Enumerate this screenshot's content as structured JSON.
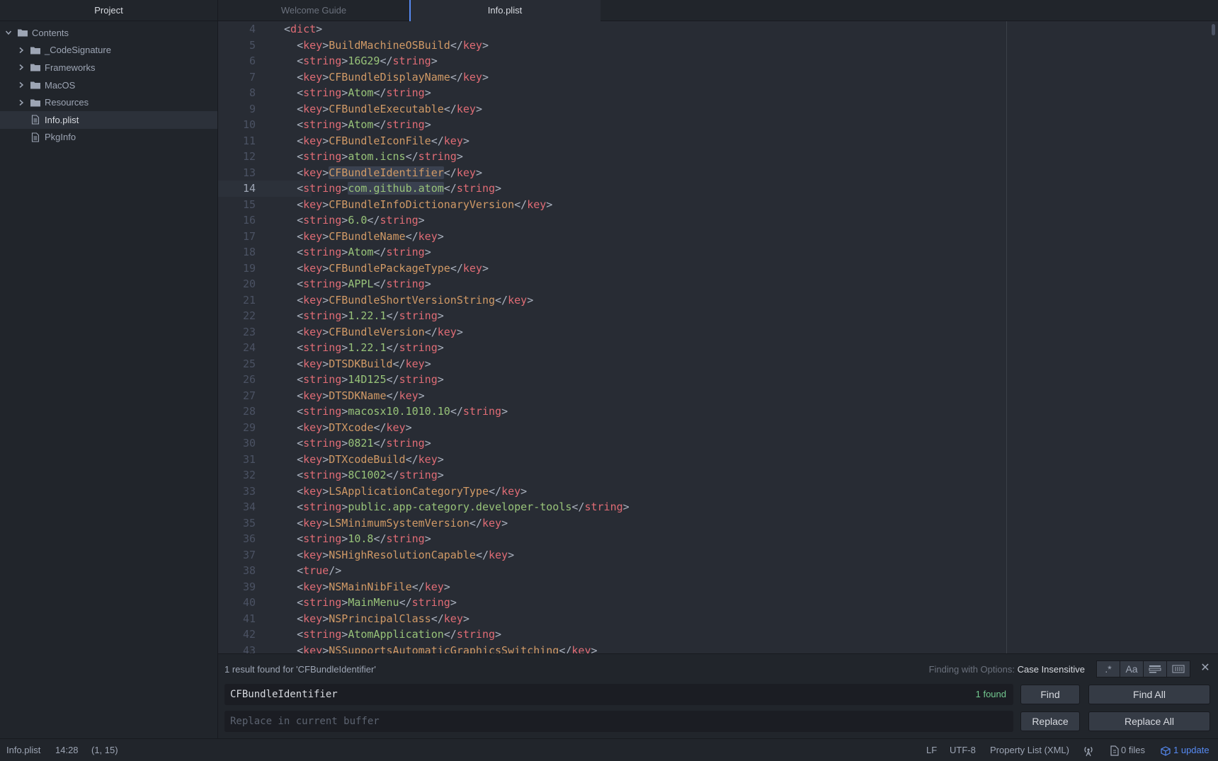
{
  "sidebar": {
    "header": "Project",
    "root": "Contents",
    "items": [
      {
        "label": "_CodeSignature",
        "type": "folder"
      },
      {
        "label": "Frameworks",
        "type": "folder"
      },
      {
        "label": "MacOS",
        "type": "folder"
      },
      {
        "label": "Resources",
        "type": "folder"
      },
      {
        "label": "Info.plist",
        "type": "file",
        "selected": true
      },
      {
        "label": "PkgInfo",
        "type": "file"
      }
    ]
  },
  "tabs": [
    {
      "label": "Welcome Guide",
      "active": false
    },
    {
      "label": "Info.plist",
      "active": true
    }
  ],
  "editor": {
    "current_line": 14,
    "lines": [
      {
        "n": "4",
        "indent": "",
        "tag": "dict",
        "kind": "open"
      },
      {
        "n": "5",
        "indent": "  ",
        "tag": "key",
        "value": "BuildMachineOSBuild"
      },
      {
        "n": "6",
        "indent": "  ",
        "tag": "string",
        "value": "16G29"
      },
      {
        "n": "7",
        "indent": "  ",
        "tag": "key",
        "value": "CFBundleDisplayName"
      },
      {
        "n": "8",
        "indent": "  ",
        "tag": "string",
        "value": "Atom"
      },
      {
        "n": "9",
        "indent": "  ",
        "tag": "key",
        "value": "CFBundleExecutable"
      },
      {
        "n": "10",
        "indent": "  ",
        "tag": "string",
        "value": "Atom"
      },
      {
        "n": "11",
        "indent": "  ",
        "tag": "key",
        "value": "CFBundleIconFile"
      },
      {
        "n": "12",
        "indent": "  ",
        "tag": "string",
        "value": "atom.icns"
      },
      {
        "n": "13",
        "indent": "  ",
        "tag": "key",
        "value": "CFBundleIdentifier",
        "highlight": true
      },
      {
        "n": "14",
        "indent": "  ",
        "tag": "string",
        "value": "com.github.atom",
        "highlight": true
      },
      {
        "n": "15",
        "indent": "  ",
        "tag": "key",
        "value": "CFBundleInfoDictionaryVersion"
      },
      {
        "n": "16",
        "indent": "  ",
        "tag": "string",
        "value": "6.0"
      },
      {
        "n": "17",
        "indent": "  ",
        "tag": "key",
        "value": "CFBundleName"
      },
      {
        "n": "18",
        "indent": "  ",
        "tag": "string",
        "value": "Atom"
      },
      {
        "n": "19",
        "indent": "  ",
        "tag": "key",
        "value": "CFBundlePackageType"
      },
      {
        "n": "20",
        "indent": "  ",
        "tag": "string",
        "value": "APPL"
      },
      {
        "n": "21",
        "indent": "  ",
        "tag": "key",
        "value": "CFBundleShortVersionString"
      },
      {
        "n": "22",
        "indent": "  ",
        "tag": "string",
        "value": "1.22.1"
      },
      {
        "n": "23",
        "indent": "  ",
        "tag": "key",
        "value": "CFBundleVersion"
      },
      {
        "n": "24",
        "indent": "  ",
        "tag": "string",
        "value": "1.22.1"
      },
      {
        "n": "25",
        "indent": "  ",
        "tag": "key",
        "value": "DTSDKBuild"
      },
      {
        "n": "26",
        "indent": "  ",
        "tag": "string",
        "value": "14D125"
      },
      {
        "n": "27",
        "indent": "  ",
        "tag": "key",
        "value": "DTSDKName"
      },
      {
        "n": "28",
        "indent": "  ",
        "tag": "string",
        "value": "macosx10.1010.10"
      },
      {
        "n": "29",
        "indent": "  ",
        "tag": "key",
        "value": "DTXcode"
      },
      {
        "n": "30",
        "indent": "  ",
        "tag": "string",
        "value": "0821"
      },
      {
        "n": "31",
        "indent": "  ",
        "tag": "key",
        "value": "DTXcodeBuild"
      },
      {
        "n": "32",
        "indent": "  ",
        "tag": "string",
        "value": "8C1002"
      },
      {
        "n": "33",
        "indent": "  ",
        "tag": "key",
        "value": "LSApplicationCategoryType"
      },
      {
        "n": "34",
        "indent": "  ",
        "tag": "string",
        "value": "public.app-category.developer-tools"
      },
      {
        "n": "35",
        "indent": "  ",
        "tag": "key",
        "value": "LSMinimumSystemVersion"
      },
      {
        "n": "36",
        "indent": "  ",
        "tag": "string",
        "value": "10.8"
      },
      {
        "n": "37",
        "indent": "  ",
        "tag": "key",
        "value": "NSHighResolutionCapable"
      },
      {
        "n": "38",
        "indent": "  ",
        "tag": "true",
        "kind": "selfclose"
      },
      {
        "n": "39",
        "indent": "  ",
        "tag": "key",
        "value": "NSMainNibFile"
      },
      {
        "n": "40",
        "indent": "  ",
        "tag": "string",
        "value": "MainMenu"
      },
      {
        "n": "41",
        "indent": "  ",
        "tag": "key",
        "value": "NSPrincipalClass"
      },
      {
        "n": "42",
        "indent": "  ",
        "tag": "string",
        "value": "AtomApplication"
      },
      {
        "n": "43",
        "indent": "  ",
        "tag": "key",
        "value": "NSSupportsAutomaticGraphicsSwitching"
      }
    ]
  },
  "find": {
    "description": "1 result found for 'CFBundleIdentifier'",
    "options_label": "Finding with Options:",
    "options_value": "Case Insensitive",
    "option_buttons": [
      ".*",
      "Aa",
      "",
      ""
    ],
    "close": "✕",
    "query": "CFBundleIdentifier",
    "found": "1 found",
    "replace_placeholder": "Replace in current buffer",
    "find_label": "Find",
    "find_all_label": "Find All",
    "replace_label": "Replace",
    "replace_all_label": "Replace All"
  },
  "status": {
    "file": "Info.plist",
    "cursor": "14:28",
    "selection": "(1, 15)",
    "line_ending": "LF",
    "encoding": "UTF-8",
    "grammar": "Property List (XML)",
    "files": "0 files",
    "update": "1 update"
  },
  "colors": {
    "accent": "#568af2",
    "tag": "#e06c75",
    "key_text": "#d19a66",
    "string_text": "#98c379",
    "found": "#73c990"
  }
}
